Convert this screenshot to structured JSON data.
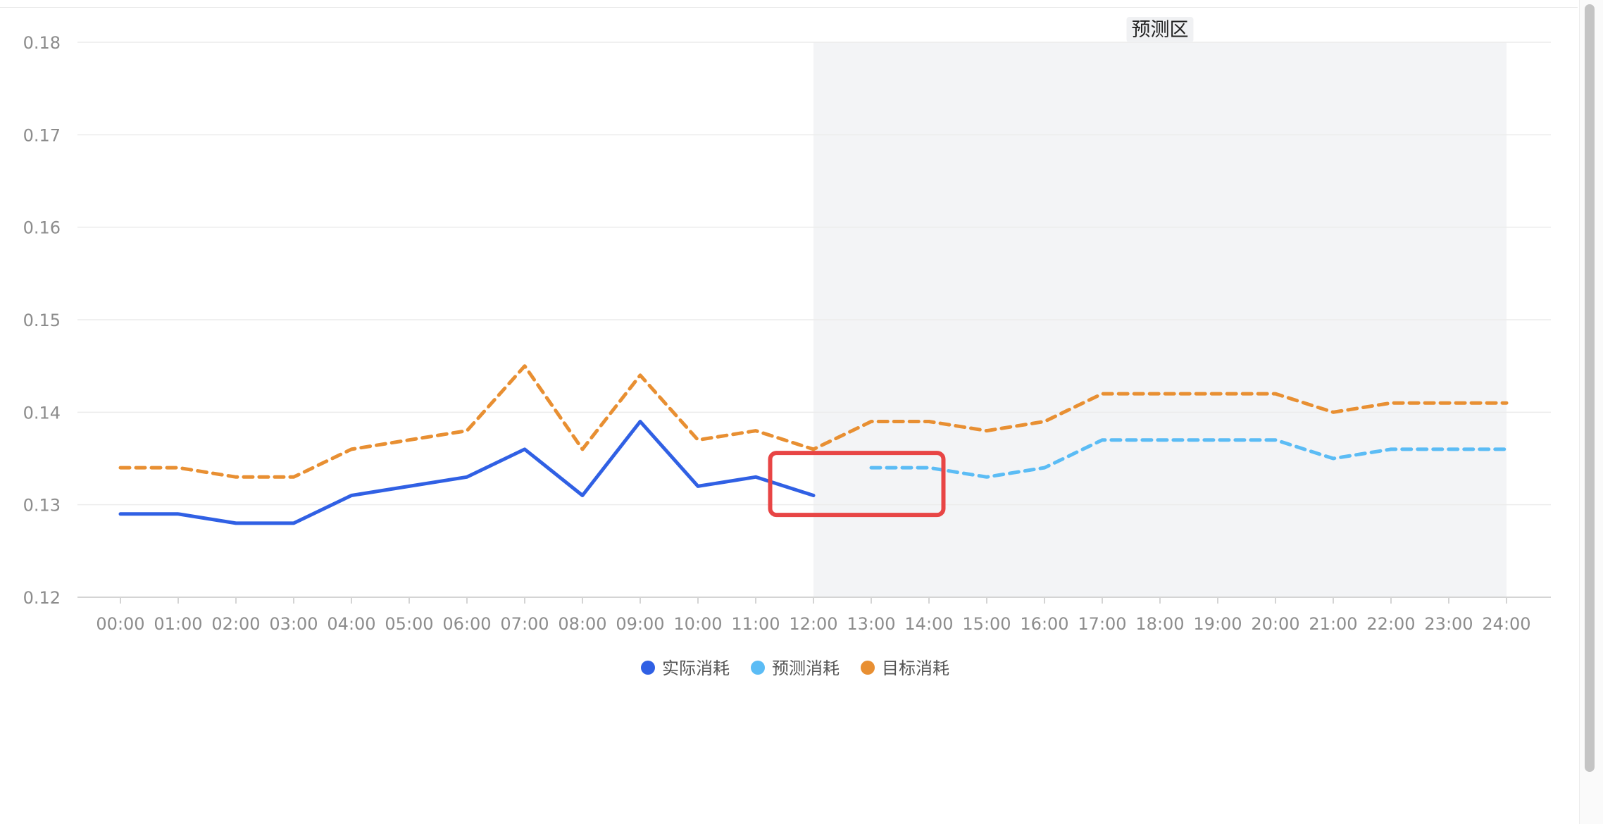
{
  "chart_data": {
    "type": "line",
    "title": "",
    "xlabel": "",
    "ylabel": "",
    "categories": [
      "00:00",
      "01:00",
      "02:00",
      "03:00",
      "04:00",
      "05:00",
      "06:00",
      "07:00",
      "08:00",
      "09:00",
      "10:00",
      "11:00",
      "12:00",
      "13:00",
      "14:00",
      "15:00",
      "16:00",
      "17:00",
      "18:00",
      "19:00",
      "20:00",
      "21:00",
      "22:00",
      "23:00",
      "24:00"
    ],
    "ylim": [
      0.12,
      0.18
    ],
    "yticks": [
      "0.12",
      "0.13",
      "0.14",
      "0.15",
      "0.16",
      "0.17",
      "0.18"
    ],
    "grid": true,
    "legend_position": "bottom-center",
    "series": [
      {
        "name": "实际消耗",
        "color": "#3060e4",
        "style": "solid",
        "values": [
          0.129,
          0.129,
          0.128,
          0.128,
          0.131,
          0.132,
          0.133,
          0.136,
          0.131,
          0.139,
          0.132,
          0.133,
          0.131,
          null,
          null,
          null,
          null,
          null,
          null,
          null,
          null,
          null,
          null,
          null,
          null
        ]
      },
      {
        "name": "预测消耗",
        "color": "#5bbcf5",
        "style": "dashed",
        "values": [
          null,
          null,
          null,
          null,
          null,
          null,
          null,
          null,
          null,
          null,
          null,
          null,
          null,
          0.134,
          0.134,
          0.133,
          0.134,
          0.137,
          0.137,
          0.137,
          0.137,
          0.135,
          0.136,
          0.136,
          0.136
        ]
      },
      {
        "name": "目标消耗",
        "color": "#e88f32",
        "style": "dashed",
        "values": [
          0.134,
          0.134,
          0.133,
          0.133,
          0.136,
          0.137,
          0.138,
          0.145,
          0.136,
          0.144,
          0.137,
          0.138,
          0.136,
          0.139,
          0.139,
          0.138,
          0.139,
          0.142,
          0.142,
          0.142,
          0.142,
          0.14,
          0.141,
          0.141,
          0.141
        ]
      }
    ],
    "shaded_region": {
      "label": "预测区",
      "from": "12:00",
      "to": "24:00",
      "color": "#f3f4f6"
    },
    "annotation": {
      "type": "highlight-box",
      "color": "#e84545",
      "x_from": "11:15",
      "x_to": "14:15",
      "y_from": 0.1289,
      "y_to": 0.1356
    }
  }
}
